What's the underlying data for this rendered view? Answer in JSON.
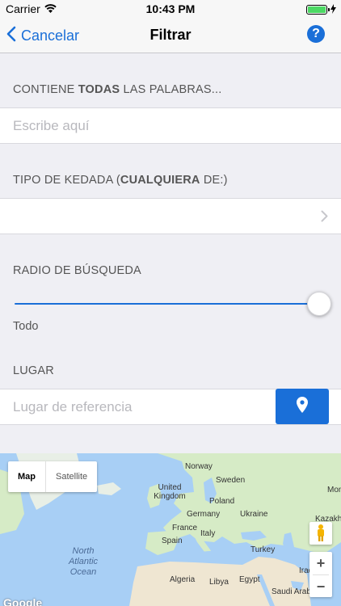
{
  "status_bar": {
    "carrier": "Carrier",
    "time": "10:43 PM"
  },
  "nav": {
    "back_label": "Cancelar",
    "title": "Filtrar",
    "help_label": "?"
  },
  "words_section": {
    "header_prefix": "CONTIENE ",
    "header_bold": "TODAS",
    "header_suffix": " LAS PALABRAS...",
    "input_placeholder": "Escribe aquí",
    "input_value": ""
  },
  "type_section": {
    "header_prefix": "TIPO DE KEDADA (",
    "header_bold": "CUALQUIERA",
    "header_suffix": " DE:)",
    "selected_value": ""
  },
  "radius_section": {
    "header": "RADIO DE BÚSQUEDA",
    "slider_fraction": 1.0,
    "value_label": "Todo"
  },
  "place_section": {
    "header": "LUGAR",
    "input_placeholder": "Lugar de referencia",
    "input_value": ""
  },
  "map": {
    "type_options": [
      "Map",
      "Satellite"
    ],
    "selected_type": "Map",
    "labels": [
      "Norway",
      "Sweden",
      "United Kingdom",
      "Poland",
      "Germany",
      "Ukraine",
      "Kazakh",
      "France",
      "Italy",
      "Spain",
      "Turkey",
      "Iraq",
      "Algeria",
      "Libya",
      "Egypt",
      "Saudi Arabia",
      "Mongolia"
    ],
    "ocean_label": "North Atlantic Ocean",
    "zoom_in": "+",
    "zoom_out": "−",
    "logo": "Google",
    "colors": {
      "water": "#a8cff5",
      "land": "#d6ebc6",
      "desert": "#efe6d2"
    }
  },
  "colors": {
    "accent": "#1a6fd8",
    "background": "#efeff4",
    "battery": "#4cd964"
  }
}
